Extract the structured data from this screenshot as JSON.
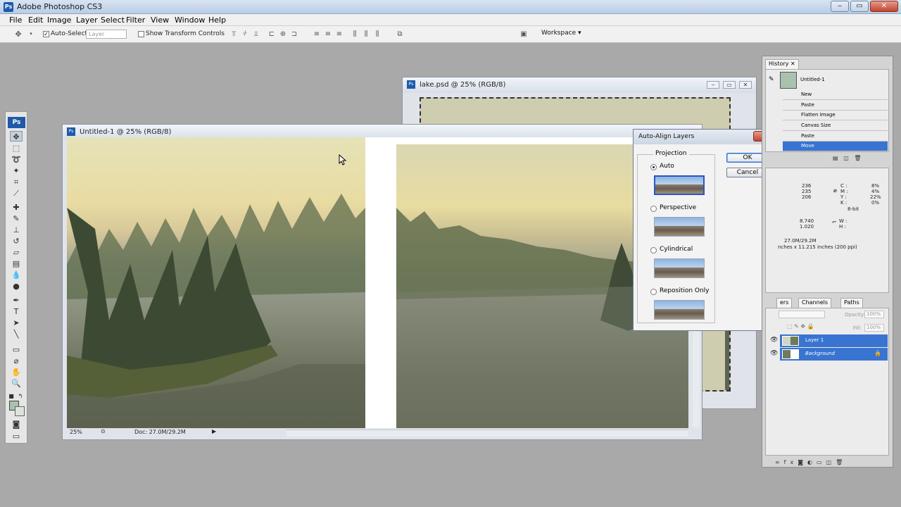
{
  "app": {
    "title": "Adobe Photoshop CS3",
    "logo": "Ps"
  },
  "menu": [
    "File",
    "Edit",
    "Image",
    "Layer",
    "Select",
    "Filter",
    "View",
    "Window",
    "Help"
  ],
  "options": {
    "auto_select_label": "Auto-Select:",
    "auto_select_value": "Layer",
    "transform_label": "Show Transform Controls",
    "workspace_label": "Workspace"
  },
  "doc_lake": {
    "title": "lake.psd @ 25% (RGB/8)"
  },
  "doc_main": {
    "title": "Untitled-1 @ 25% (RGB/8)",
    "zoom": "25%",
    "doc_info": "Doc: 27.0M/29.2M"
  },
  "dialog": {
    "title": "Auto-Align Layers",
    "group_label": "Projection",
    "options": [
      "Auto",
      "Perspective",
      "Cylindrical",
      "Reposition Only"
    ],
    "ok": "OK",
    "cancel": "Cancel"
  },
  "history": {
    "tab": "History",
    "snapshot": "Untitled-1",
    "items": [
      "New",
      "Paste",
      "Flatten Image",
      "Canvas Size",
      "Paste",
      "Move"
    ]
  },
  "info": {
    "r": "236",
    "g": "235",
    "b": "206",
    "c_lbl": "C :",
    "m_lbl": "M :",
    "y_lbl": "Y :",
    "k_lbl": "K :",
    "c": "8%",
    "m": "4%",
    "y": "22%",
    "k": "0%",
    "bit": "8-bit",
    "x": "8.740",
    "y2": "1.020",
    "w_lbl": "W :",
    "h_lbl": "H :",
    "doc": "27.0M/29.2M",
    "size": "nches x 11.215 inches (200 ppi)"
  },
  "layers_panel": {
    "tabs": [
      "ers",
      "Channels",
      "Paths"
    ],
    "opacity_label": "Opacity:",
    "opacity": "100%",
    "fill_label": "Fill:",
    "fill": "100%",
    "layers": [
      "Layer 1",
      "Background"
    ]
  }
}
